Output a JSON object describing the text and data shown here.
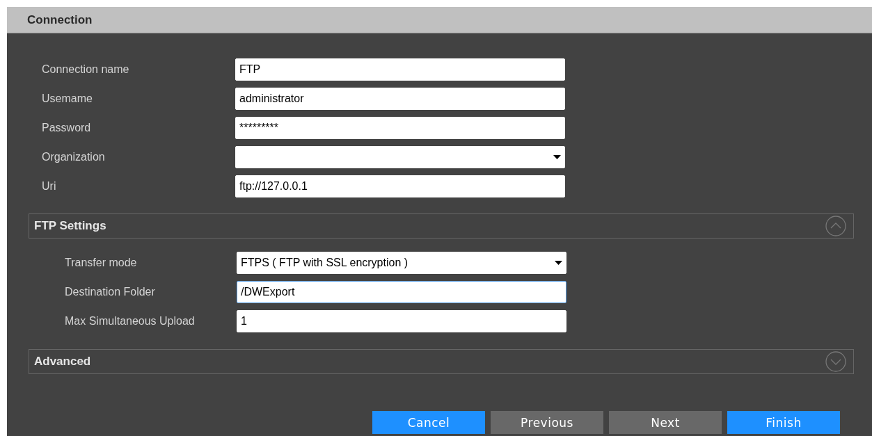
{
  "header": {
    "title": "Connection"
  },
  "fields": [
    {
      "label": "Connection name",
      "kind": "text",
      "value": "FTP",
      "focused": false
    },
    {
      "label": "Usemame",
      "kind": "text",
      "value": "administrator",
      "focused": false
    },
    {
      "label": "Password",
      "kind": "password",
      "value": "*********",
      "focused": false
    },
    {
      "label": "Organization",
      "kind": "dropdown",
      "focused": false
    },
    {
      "label": "Uri",
      "kind": "text",
      "value": "ftp://127.0.0.1",
      "focused": false
    }
  ],
  "sections": [
    {
      "title": "FTP Settings",
      "expanded": true,
      "fields": [
        {
          "label": "Transfer mode",
          "kind": "dropdown",
          "value": "FTPS ( FTP with SSL encryption )",
          "focused": false
        },
        {
          "label": "Destination Folder",
          "kind": "text",
          "value": "/DWExport",
          "focused": true
        },
        {
          "label": "Max Simultaneous Upload",
          "kind": "text",
          "value": "1",
          "focused": false
        }
      ]
    },
    {
      "title": "Advanced",
      "expanded": false
    }
  ],
  "buttons": [
    {
      "label": "Cancel",
      "kind": "primary"
    },
    {
      "label": "Previous",
      "kind": "secondary"
    },
    {
      "label": "Next",
      "kind": "secondary"
    },
    {
      "label": "Finish",
      "kind": "primary"
    }
  ]
}
